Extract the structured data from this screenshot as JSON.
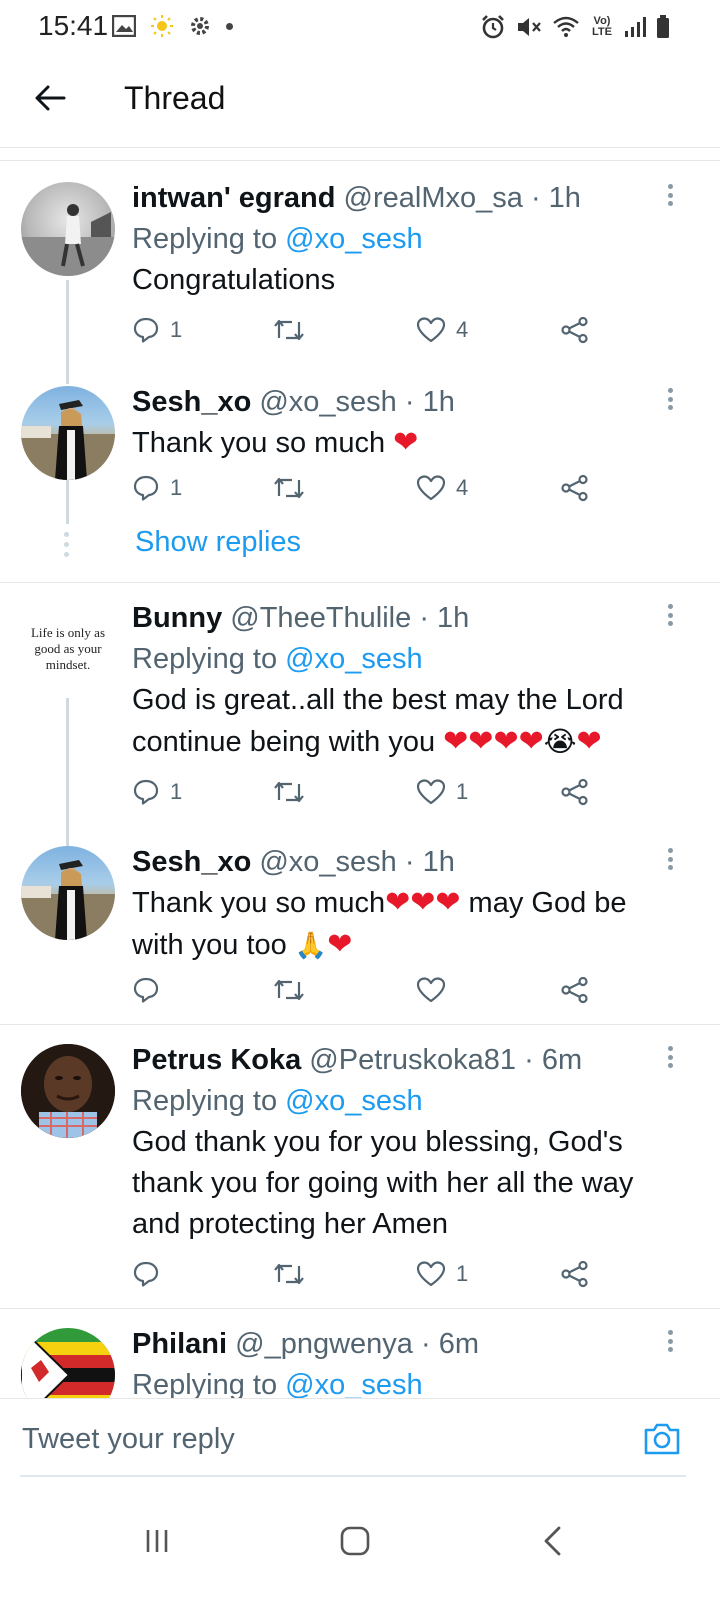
{
  "status_bar": {
    "time": "15:41",
    "network_label": "Vo) LTE",
    "icons_left": [
      "gallery-icon",
      "sun-icon",
      "gear-icon",
      "dot"
    ],
    "icons_right": [
      "alarm-icon",
      "mute-icon",
      "wifi-icon",
      "lte-icon",
      "signal-icon",
      "battery-icon"
    ]
  },
  "header": {
    "title": "Thread",
    "back_icon": "arrow-left-icon"
  },
  "tweets": [
    {
      "name": "intwan' egrand",
      "handle": "@realMxo_sa",
      "time": "· 1h",
      "replying_prefix": "Replying to",
      "replying_to": "@xo_sesh",
      "text": "Congratulations",
      "replies": "1",
      "retweets": "",
      "likes": "4"
    },
    {
      "name": "Sesh_xo",
      "handle": "@xo_sesh",
      "time": "· 1h",
      "text": "Thank you so much",
      "replies": "1",
      "retweets": "",
      "likes": "4"
    },
    {
      "name": "Bunny",
      "handle": "@TheeThulile",
      "time": "· 1h",
      "avatar_text": "Life is only as good as your mindset.",
      "replying_prefix": "Replying to",
      "replying_to": "@xo_sesh",
      "text_line1": "God is great..all the best may the Lord",
      "text_line2": "continue being with you",
      "replies": "1",
      "retweets": "",
      "likes": "1"
    },
    {
      "name": "Sesh_xo",
      "handle": "@xo_sesh",
      "time": "· 1h",
      "text_a": "Thank you so much",
      "text_b": " may God be",
      "text_c": "with you too",
      "replies": "",
      "retweets": "",
      "likes": ""
    },
    {
      "name": "Petrus Koka",
      "handle": "@Petruskoka81",
      "time": "· 6m",
      "replying_prefix": "Replying to",
      "replying_to": "@xo_sesh",
      "text_line1": "God thank you for you blessing, God's",
      "text_line2": "thank you for going with her all the way",
      "text_line3": "and protecting her Amen",
      "replies": "",
      "retweets": "",
      "likes": "1"
    },
    {
      "name": "Philani",
      "handle": "@_pngwenya",
      "time": "· 6m",
      "replying_prefix": "Replying to",
      "replying_to": "@xo_sesh"
    }
  ],
  "show_replies_label": "Show replies",
  "reply_bar": {
    "placeholder": "Tweet your reply",
    "camera_icon": "camera-icon"
  },
  "navbar": {
    "recent_icon": "recent-apps-icon",
    "home_icon": "home-icon",
    "back_icon": "back-icon"
  },
  "colors": {
    "accent": "#1d9bf0",
    "heart": "#e8182b",
    "text_secondary": "#536471"
  }
}
